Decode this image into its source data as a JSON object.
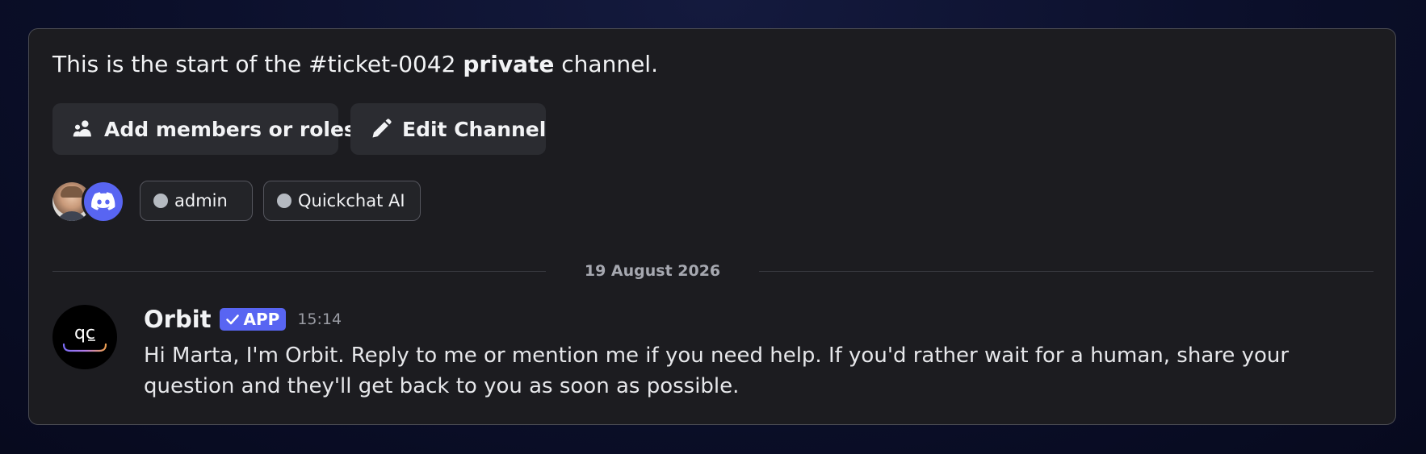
{
  "intro": {
    "prefix": "This is the start of the #ticket-0042 ",
    "emphasis": "private",
    "suffix": " channel."
  },
  "buttons": {
    "add_members": "Add members or roles",
    "edit_channel": "Edit Channel"
  },
  "members": [
    {
      "name": "admin",
      "status": "offline"
    },
    {
      "name": "Quickchat AI",
      "status": "offline"
    }
  ],
  "divider": {
    "date": "19 August 2026"
  },
  "message": {
    "author": "Orbit",
    "tag": "APP",
    "time": "15:14",
    "avatar_text": "qc",
    "text": "Hi Marta, I'm Orbit. Reply to me or mention me if you need help. If you'd rather wait for a human, share your question and they'll get back to you as soon as possible."
  },
  "colors": {
    "accent": "#5865f2",
    "panel": "#1c1c20",
    "button": "#2b2c31",
    "status_offline": "#b5bac1"
  },
  "icons": {
    "add_members": "add-people-icon",
    "edit_channel": "pencil-icon",
    "app_tag": "checkmark-icon",
    "discord_avatar": "discord-logo-icon"
  }
}
